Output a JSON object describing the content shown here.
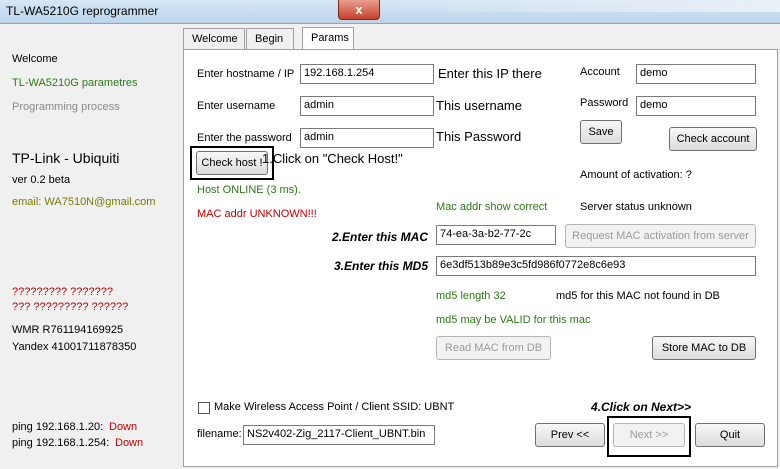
{
  "window": {
    "title": "TL-WA5210G reprogrammer",
    "close_glyph": "x"
  },
  "sidebar": {
    "welcome": "Welcome",
    "parametres": "TL-WA5210G parametres",
    "programming": "Programming process",
    "brand": "TP-Link - Ubiquiti",
    "version": "ver 0.2 beta",
    "email": "email: WA7510N@gmail.com",
    "q1": "????????? ???????",
    "q2": "??? ????????? ??????",
    "wmr": "WMR R761194169925",
    "yandex": "Yandex 41001711878350",
    "ping1_label": "ping 192.168.1.20:",
    "ping1_status": "Down",
    "ping2_label": "ping 192.168.1.254:",
    "ping2_status": "Down"
  },
  "tabs": [
    {
      "label": "Welcome"
    },
    {
      "label": "Begin"
    },
    {
      "label": "Params"
    }
  ],
  "form": {
    "hostname_label": "Enter hostname / IP",
    "hostname_value": "192.168.1.254",
    "username_label": "Enter username",
    "username_value": "admin",
    "password_label": "Enter the password",
    "password_value": "admin",
    "check_host": "Check host !",
    "host_status": "Host ONLINE (3 ms).",
    "mac_status": "MAC addr UNKNOWN!!!",
    "mac_correct": "Mac addr show correct",
    "mac_value": "74-ea-3a-b2-77-2c",
    "md5_value": "6e3df513b89e3c5fd986f0772e8c6e93",
    "request_mac": "Request MAC activation from server",
    "md5_length": "md5 length 32",
    "md5_not_found": "md5 for this MAC not found in DB",
    "md5_valid": "md5 may be VALID for this mac",
    "read_mac": "Read MAC from DB",
    "store_mac": "Store MAC to DB"
  },
  "account": {
    "account_label": "Account",
    "account_value": "demo",
    "password_label": "Password",
    "password_value": "demo",
    "save": "Save",
    "check_account": "Check account",
    "amount": "Amount of activation: ?",
    "server_status": "Server status unknown"
  },
  "bottom": {
    "wireless_label": "Make Wireless Access Point / Client SSID: UBNT",
    "filename_label": "filename:",
    "filename_value": "NS2v402-Zig_2117-Client_UBNT.bin",
    "prev": "Prev <<",
    "next": "Next >>",
    "quit": "Quit"
  },
  "annotations": {
    "ip": "Enter this IP there",
    "username": "This username",
    "password": "This Password",
    "check_host": "1.Click on \"Check Host!\"",
    "mac": "2.Enter this MAC",
    "md5": "3.Enter this MD5",
    "next": "4.Click on Next>>"
  }
}
